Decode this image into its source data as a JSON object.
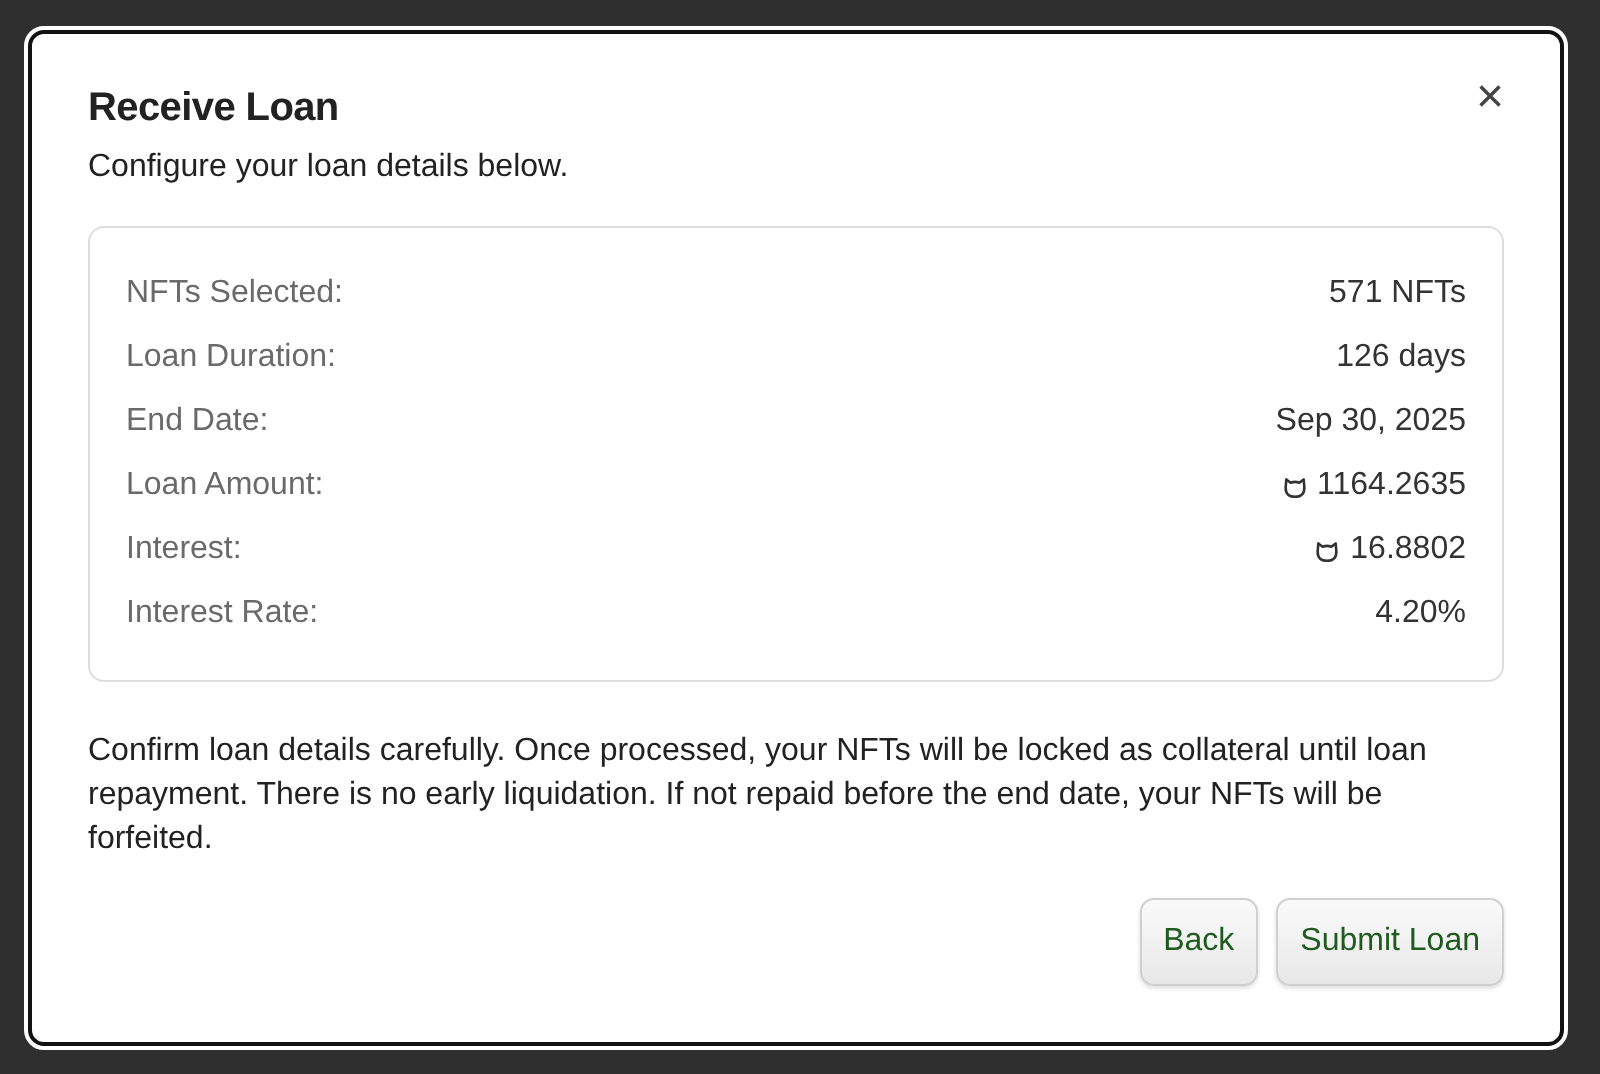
{
  "dialog": {
    "title": "Receive Loan",
    "subtitle": "Configure your loan details below.",
    "close": "×"
  },
  "details": [
    {
      "label": "NFTs Selected:",
      "value": "571 NFTs",
      "token": false
    },
    {
      "label": "Loan Duration:",
      "value": "126 days",
      "token": false
    },
    {
      "label": "End Date:",
      "value": "Sep 30, 2025",
      "token": false
    },
    {
      "label": "Loan Amount:",
      "value": "1164.2635",
      "token": true
    },
    {
      "label": "Interest:",
      "value": "16.8802",
      "token": true
    },
    {
      "label": "Interest Rate:",
      "value": "4.20%",
      "token": false
    }
  ],
  "notice": "Confirm loan details carefully. Once processed, your NFTs will be locked as collateral until loan repayment. There is no early liquidation. If not repaid before the end date, your NFTs will be forfeited.",
  "buttons": [
    "Back",
    "Submit Loan"
  ]
}
